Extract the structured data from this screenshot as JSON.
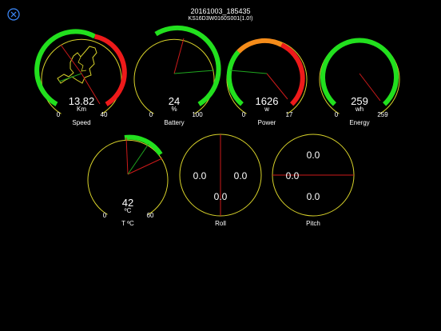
{
  "header": {
    "title": "20161003_185435",
    "subtitle": "KS16D3W0160S001(1.0!)"
  },
  "icons": {
    "close": "close-icon"
  },
  "gauges": [
    {
      "id": "speed",
      "label": "Speed",
      "value": "13.82",
      "unit": "Km",
      "min": "0",
      "max": "40"
    },
    {
      "id": "battery",
      "label": "Battery",
      "value": "24",
      "unit": "%",
      "min": "0",
      "max": "100"
    },
    {
      "id": "power",
      "label": "Power",
      "value": "1626",
      "unit": "w",
      "min": "0",
      "max": "17"
    },
    {
      "id": "energy",
      "label": "Energy",
      "value": "259",
      "unit": "wh",
      "min": "0",
      "max": "259"
    },
    {
      "id": "temp",
      "label": "T ºC",
      "value": "42",
      "unit": "ºC",
      "min": "0",
      "max": "60"
    }
  ],
  "roll": {
    "label": "Roll",
    "left": "0.0",
    "right": "0.0",
    "bottom": "0.0"
  },
  "pitch": {
    "label": "Pitch",
    "top": "0.0",
    "left": "0.0",
    "bottom": "0.0"
  },
  "colors": {
    "yellow": "#d8d22a",
    "green": "#22e01e",
    "red": "#ee1a1a",
    "orange": "#f58c1a",
    "needle_red": "#cc1a1a",
    "needle_green": "#1fa51f"
  }
}
